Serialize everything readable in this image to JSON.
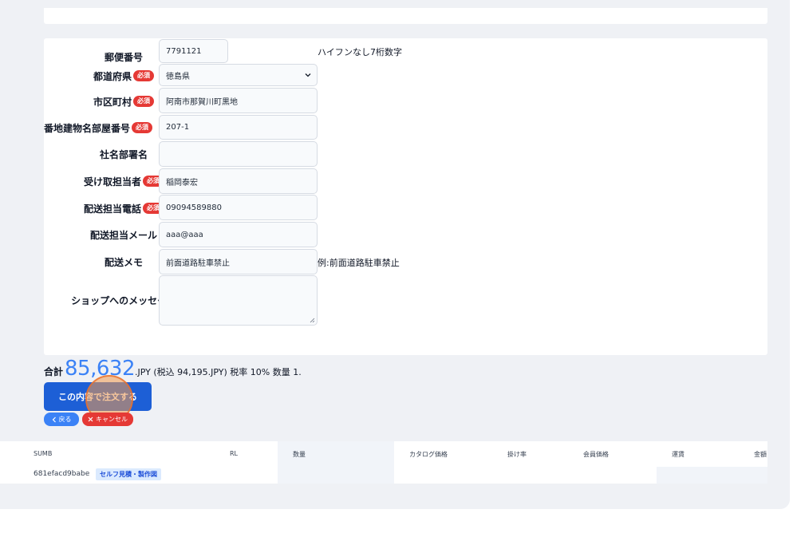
{
  "form": {
    "postal": {
      "label": "郵便番号",
      "value": "7791121",
      "hint": "ハイフンなし7桁数字"
    },
    "prefecture": {
      "label": "都道府県",
      "value": "徳島県"
    },
    "city": {
      "label": "市区町村",
      "value": "阿南市那賀川町黒地"
    },
    "address": {
      "label": "番地建物名部屋番号",
      "value": "207-1"
    },
    "company": {
      "label": "社名部署名",
      "value": ""
    },
    "recipient": {
      "label": "受け取担当者",
      "value": "稲岡泰宏"
    },
    "phone": {
      "label": "配送担当電話",
      "value": "09094589880"
    },
    "email": {
      "label": "配送担当メール",
      "value": "aaa@aaa"
    },
    "memo": {
      "label": "配送メモ",
      "value": "前面道路駐車禁止",
      "hint": "例:前面道路駐車禁止"
    },
    "message": {
      "label": "ショップへのメッセージ",
      "value": ""
    },
    "required_badge": "必須"
  },
  "summary": {
    "total_label": "合計",
    "total_value": "85,632",
    "total_rest": ".JPY (税込 94,195.JPY) 税率 10% 数量 1."
  },
  "buttons": {
    "order": "この内容で注文する",
    "back": "戻る",
    "cancel": "キャンセル"
  },
  "table": {
    "headers": [
      "SUMB",
      "RL",
      "数量",
      "カタログ価格",
      "掛け率",
      "会員価格",
      "運賃",
      "金額"
    ],
    "row": {
      "id": "681efacd9babe",
      "badge": "セルフ見積・製作図"
    }
  },
  "colors": {
    "accent": "#3b82f6",
    "primary_button": "#1d5fd6",
    "danger": "#e53935"
  }
}
